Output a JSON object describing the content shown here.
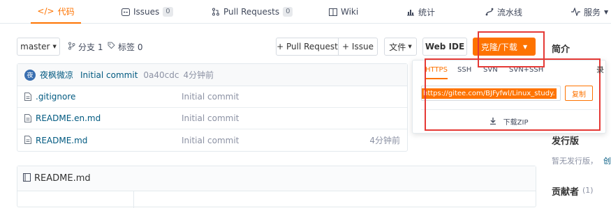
{
  "nav": {
    "code": "代码",
    "issues": "Issues",
    "issues_count": "0",
    "pr": "Pull Requests",
    "pr_count": "0",
    "wiki": "Wiki",
    "stats": "统计",
    "pipeline": "流水线",
    "service": "服务"
  },
  "toolbar": {
    "branch": "master",
    "branches": "分支 1",
    "tags": "标签 0",
    "pull_request": "+ Pull Request",
    "issue": "+ Issue",
    "file": "文件",
    "web_ide": "Web IDE",
    "clone": "克隆/下载"
  },
  "commit": {
    "avatar": "夜",
    "author": "夜枫微凉",
    "message": "Initial commit",
    "hash": "0a40cdc",
    "time": "4分钟前"
  },
  "files": [
    {
      "name": ".gitignore",
      "message": "Initial commit",
      "time": ""
    },
    {
      "name": "README.en.md",
      "message": "Initial commit",
      "time": ""
    },
    {
      "name": "README.md",
      "message": "Initial commit",
      "time": "4分钟前"
    }
  ],
  "readme": {
    "title": "README.md"
  },
  "clone_panel": {
    "tabs": [
      "HTTPS",
      "SSH",
      "SVN",
      "SVN+SSH"
    ],
    "url": "https://gitee.com/BJFyfwl/Linux_study.",
    "copy": "复制",
    "download_zip": "下载ZIP"
  },
  "sidebar": {
    "intro": "简介",
    "edge_char": "录",
    "releases": "发行版",
    "no_release": "暂无发行版，",
    "create": "创",
    "contributors": "贡献者",
    "contributors_count": "(1)"
  },
  "colors": {
    "accent": "#fe7300",
    "highlight_box": "#e53935",
    "link": "#005980"
  }
}
